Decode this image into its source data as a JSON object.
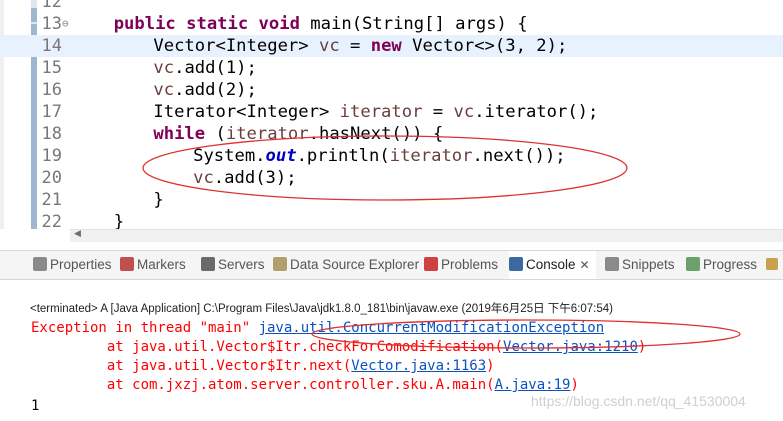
{
  "editor": {
    "lines": [
      {
        "num": "12",
        "text": ""
      },
      {
        "num": "13",
        "fold": "⊖",
        "segments": [
          [
            "kw",
            "public static void"
          ],
          [
            "plain",
            " main(String[] args) {"
          ]
        ]
      },
      {
        "num": "14",
        "current": true,
        "segments": [
          [
            "plain",
            "Vector<Integer> "
          ],
          [
            "var",
            "vc"
          ],
          [
            "plain",
            " = "
          ],
          [
            "kw",
            "new"
          ],
          [
            "plain",
            " Vector<>(3, 2);"
          ]
        ]
      },
      {
        "num": "15",
        "segments": [
          [
            "var",
            "vc"
          ],
          [
            "plain",
            ".add(1);"
          ]
        ]
      },
      {
        "num": "16",
        "segments": [
          [
            "var",
            "vc"
          ],
          [
            "plain",
            ".add(2);"
          ]
        ]
      },
      {
        "num": "17",
        "segments": [
          [
            "plain",
            "Iterator<Integer> "
          ],
          [
            "var",
            "iterator"
          ],
          [
            "plain",
            " = "
          ],
          [
            "var",
            "vc"
          ],
          [
            "plain",
            ".iterator();"
          ]
        ]
      },
      {
        "num": "18",
        "segments": [
          [
            "kw",
            "while"
          ],
          [
            "plain",
            " ("
          ],
          [
            "var",
            "iterator"
          ],
          [
            "plain",
            ".hasNext()) {"
          ]
        ]
      },
      {
        "num": "19",
        "segments": [
          [
            "plain",
            "System."
          ],
          [
            "field",
            "out"
          ],
          [
            "plain",
            ".println("
          ],
          [
            "var",
            "iterator"
          ],
          [
            "plain",
            ".next());"
          ]
        ]
      },
      {
        "num": "20",
        "segments": [
          [
            "var",
            "vc"
          ],
          [
            "plain",
            ".add(3);"
          ]
        ]
      },
      {
        "num": "21",
        "segments": [
          [
            "plain",
            "}"
          ]
        ]
      },
      {
        "num": "22",
        "segments": [
          [
            "plain",
            "}"
          ]
        ]
      }
    ]
  },
  "tabs": [
    {
      "label": "Properties",
      "icon": "properties-icon",
      "color": "#8a8a8a"
    },
    {
      "label": "Markers",
      "icon": "markers-icon",
      "color": "#c05050"
    },
    {
      "label": "Servers",
      "icon": "servers-icon",
      "color": "#6a6a6a"
    },
    {
      "label": "Data Source Explorer",
      "icon": "data-source-icon",
      "color": "#b0a070"
    },
    {
      "label": "Problems",
      "icon": "problems-icon",
      "color": "#d04040"
    },
    {
      "label": "Console",
      "icon": "console-icon",
      "color": "#3c6aa0",
      "active": true,
      "close": "✕"
    },
    {
      "label": "Snippets",
      "icon": "snippets-icon",
      "color": "#8a8a8a"
    },
    {
      "label": "Progress",
      "icon": "progress-icon",
      "color": "#6aa06a"
    }
  ],
  "console": {
    "header": "<terminated> A [Java Application] C:\\Program Files\\Java\\jdk1.8.0_181\\bin\\javaw.exe (2019年6月25日 下午6:07:54)",
    "exception_prefix": "Exception in thread \"main\" ",
    "exception_class": "java.util.ConcurrentModificationException",
    "trace": [
      {
        "prefix": "\tat java.util.Vector$Itr.checkForComodification(",
        "link": "Vector.java:1210",
        "suffix": ")"
      },
      {
        "prefix": "\tat java.util.Vector$Itr.next(",
        "link": "Vector.java:1163",
        "suffix": ")"
      },
      {
        "prefix": "\tat com.jxzj.atom.server.controller.sku.A.main(",
        "link": "A.java:19",
        "suffix": ")"
      }
    ],
    "output": "1"
  },
  "watermark": "https://blog.csdn.net/qq_41530004",
  "colors": {
    "annotation": "#e03030",
    "keyword": "#7f0055",
    "link": "#0b52bf",
    "error": "#ff0000"
  }
}
